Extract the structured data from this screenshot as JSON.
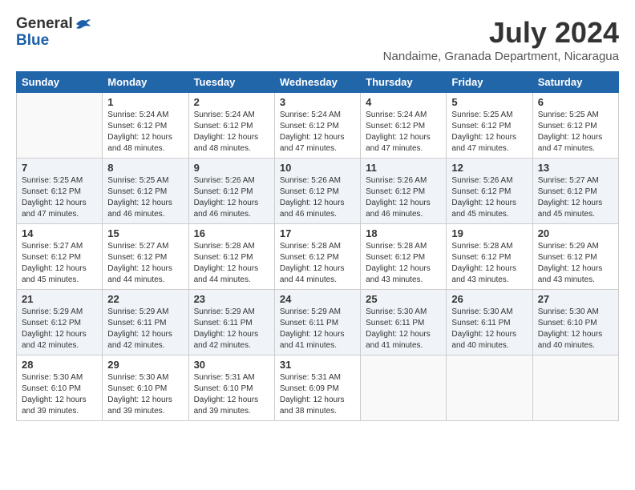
{
  "header": {
    "logo_general": "General",
    "logo_blue": "Blue",
    "month_year": "July 2024",
    "location": "Nandaime, Granada Department, Nicaragua"
  },
  "calendar": {
    "days_of_week": [
      "Sunday",
      "Monday",
      "Tuesday",
      "Wednesday",
      "Thursday",
      "Friday",
      "Saturday"
    ],
    "weeks": [
      [
        {
          "day": "",
          "info": ""
        },
        {
          "day": "1",
          "info": "Sunrise: 5:24 AM\nSunset: 6:12 PM\nDaylight: 12 hours\nand 48 minutes."
        },
        {
          "day": "2",
          "info": "Sunrise: 5:24 AM\nSunset: 6:12 PM\nDaylight: 12 hours\nand 48 minutes."
        },
        {
          "day": "3",
          "info": "Sunrise: 5:24 AM\nSunset: 6:12 PM\nDaylight: 12 hours\nand 47 minutes."
        },
        {
          "day": "4",
          "info": "Sunrise: 5:24 AM\nSunset: 6:12 PM\nDaylight: 12 hours\nand 47 minutes."
        },
        {
          "day": "5",
          "info": "Sunrise: 5:25 AM\nSunset: 6:12 PM\nDaylight: 12 hours\nand 47 minutes."
        },
        {
          "day": "6",
          "info": "Sunrise: 5:25 AM\nSunset: 6:12 PM\nDaylight: 12 hours\nand 47 minutes."
        }
      ],
      [
        {
          "day": "7",
          "info": "Sunrise: 5:25 AM\nSunset: 6:12 PM\nDaylight: 12 hours\nand 47 minutes."
        },
        {
          "day": "8",
          "info": "Sunrise: 5:25 AM\nSunset: 6:12 PM\nDaylight: 12 hours\nand 46 minutes."
        },
        {
          "day": "9",
          "info": "Sunrise: 5:26 AM\nSunset: 6:12 PM\nDaylight: 12 hours\nand 46 minutes."
        },
        {
          "day": "10",
          "info": "Sunrise: 5:26 AM\nSunset: 6:12 PM\nDaylight: 12 hours\nand 46 minutes."
        },
        {
          "day": "11",
          "info": "Sunrise: 5:26 AM\nSunset: 6:12 PM\nDaylight: 12 hours\nand 46 minutes."
        },
        {
          "day": "12",
          "info": "Sunrise: 5:26 AM\nSunset: 6:12 PM\nDaylight: 12 hours\nand 45 minutes."
        },
        {
          "day": "13",
          "info": "Sunrise: 5:27 AM\nSunset: 6:12 PM\nDaylight: 12 hours\nand 45 minutes."
        }
      ],
      [
        {
          "day": "14",
          "info": "Sunrise: 5:27 AM\nSunset: 6:12 PM\nDaylight: 12 hours\nand 45 minutes."
        },
        {
          "day": "15",
          "info": "Sunrise: 5:27 AM\nSunset: 6:12 PM\nDaylight: 12 hours\nand 44 minutes."
        },
        {
          "day": "16",
          "info": "Sunrise: 5:28 AM\nSunset: 6:12 PM\nDaylight: 12 hours\nand 44 minutes."
        },
        {
          "day": "17",
          "info": "Sunrise: 5:28 AM\nSunset: 6:12 PM\nDaylight: 12 hours\nand 44 minutes."
        },
        {
          "day": "18",
          "info": "Sunrise: 5:28 AM\nSunset: 6:12 PM\nDaylight: 12 hours\nand 43 minutes."
        },
        {
          "day": "19",
          "info": "Sunrise: 5:28 AM\nSunset: 6:12 PM\nDaylight: 12 hours\nand 43 minutes."
        },
        {
          "day": "20",
          "info": "Sunrise: 5:29 AM\nSunset: 6:12 PM\nDaylight: 12 hours\nand 43 minutes."
        }
      ],
      [
        {
          "day": "21",
          "info": "Sunrise: 5:29 AM\nSunset: 6:12 PM\nDaylight: 12 hours\nand 42 minutes."
        },
        {
          "day": "22",
          "info": "Sunrise: 5:29 AM\nSunset: 6:11 PM\nDaylight: 12 hours\nand 42 minutes."
        },
        {
          "day": "23",
          "info": "Sunrise: 5:29 AM\nSunset: 6:11 PM\nDaylight: 12 hours\nand 42 minutes."
        },
        {
          "day": "24",
          "info": "Sunrise: 5:29 AM\nSunset: 6:11 PM\nDaylight: 12 hours\nand 41 minutes."
        },
        {
          "day": "25",
          "info": "Sunrise: 5:30 AM\nSunset: 6:11 PM\nDaylight: 12 hours\nand 41 minutes."
        },
        {
          "day": "26",
          "info": "Sunrise: 5:30 AM\nSunset: 6:11 PM\nDaylight: 12 hours\nand 40 minutes."
        },
        {
          "day": "27",
          "info": "Sunrise: 5:30 AM\nSunset: 6:10 PM\nDaylight: 12 hours\nand 40 minutes."
        }
      ],
      [
        {
          "day": "28",
          "info": "Sunrise: 5:30 AM\nSunset: 6:10 PM\nDaylight: 12 hours\nand 39 minutes."
        },
        {
          "day": "29",
          "info": "Sunrise: 5:30 AM\nSunset: 6:10 PM\nDaylight: 12 hours\nand 39 minutes."
        },
        {
          "day": "30",
          "info": "Sunrise: 5:31 AM\nSunset: 6:10 PM\nDaylight: 12 hours\nand 39 minutes."
        },
        {
          "day": "31",
          "info": "Sunrise: 5:31 AM\nSunset: 6:09 PM\nDaylight: 12 hours\nand 38 minutes."
        },
        {
          "day": "",
          "info": ""
        },
        {
          "day": "",
          "info": ""
        },
        {
          "day": "",
          "info": ""
        }
      ]
    ]
  }
}
